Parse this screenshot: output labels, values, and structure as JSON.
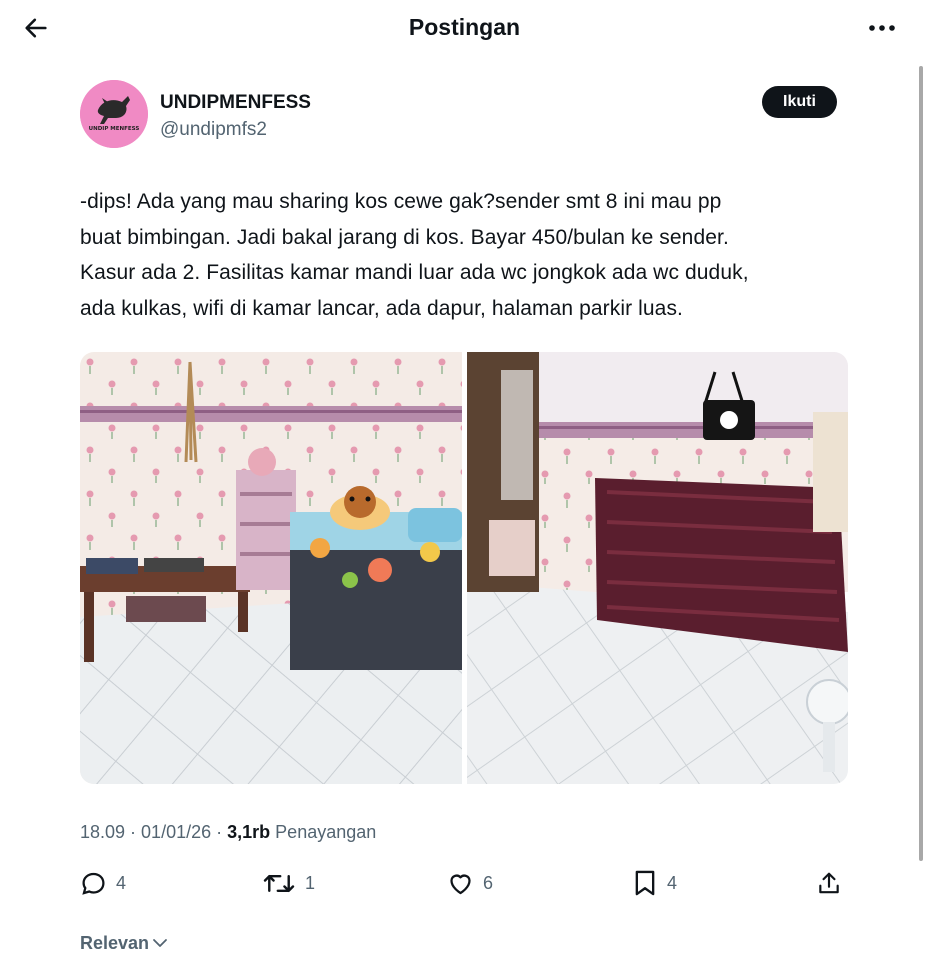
{
  "header": {
    "title": "Postingan",
    "back_icon": "arrow-left-icon",
    "more_icon": "more-horizontal-icon"
  },
  "author": {
    "display_name": "UNDIPMENFESS",
    "handle": "@undipmfs2",
    "avatar_text": "UNDIP MENFESS",
    "avatar_color": "#f08ac4"
  },
  "follow_label": "Ikuti",
  "post": {
    "lines": [
      "-dips! Ada yang mau sharing kos cewe gak?sender smt 8 ini mau pp",
      "buat bimbingan. Jadi bakal jarang di kos. Bayar 450/bulan ke sender.",
      "Kasur ada 2. Fasilitas kamar mandi luar ada wc jongkok ada wc duduk,",
      "ada kulkas, wifi di kamar lancar, ada dapur, halaman parkir luas."
    ],
    "photos": [
      "bedroom-with-bed-and-shelf-photo",
      "bedroom-with-wardrobe-and-mattress-photo"
    ]
  },
  "meta": {
    "time": "18.09",
    "date": "01/01/26",
    "separator": " · ",
    "views_count": "3,1rb",
    "views_label": "Penayangan"
  },
  "actions": {
    "reply": {
      "icon": "reply-icon",
      "count": "4"
    },
    "repost": {
      "icon": "repost-icon",
      "count": "1"
    },
    "like": {
      "icon": "heart-icon",
      "count": "6"
    },
    "bookmark": {
      "icon": "bookmark-icon",
      "count": "4"
    },
    "share": {
      "icon": "share-icon"
    }
  },
  "sort": {
    "label": "Relevan",
    "icon": "chevron-down-icon"
  },
  "colors": {
    "text": "#0f1419",
    "secondary": "#536471",
    "button": "#0f1419"
  }
}
